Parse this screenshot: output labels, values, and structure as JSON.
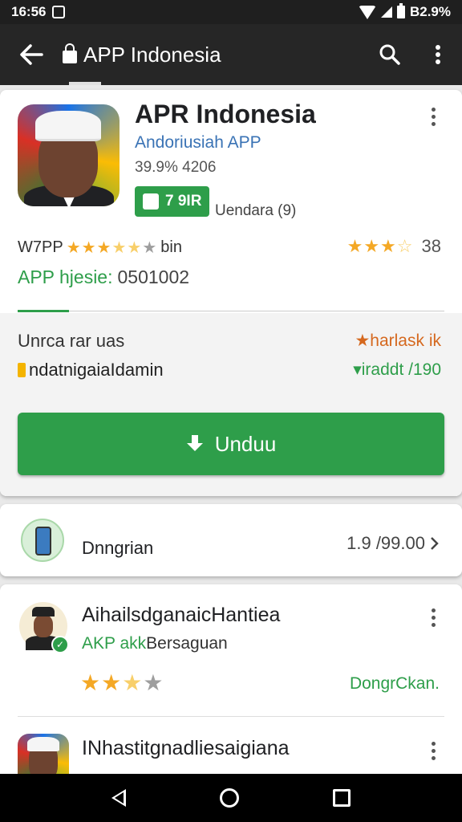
{
  "status": {
    "time": "16:56",
    "battery": "B2.9%"
  },
  "appbar": {
    "title": "APP Indonesia"
  },
  "app": {
    "name": "APR Indonesia",
    "developer": "Andoriusiah APP",
    "meta": "39.9%  4206",
    "badge": "7 9IR",
    "badge_aside": "Uendara (9)",
    "stats_left": "W7PP",
    "stats_left_suffix": "bin",
    "stars_left": 3.5,
    "stars_right": 3.5,
    "review_count": "38",
    "size_label": "APP hjesie:",
    "size_value": "0501002"
  },
  "info": {
    "line1": "Unrca rar uas",
    "line2": "ndatnigaiaIdamin",
    "line1_right": "★harlask ik",
    "line2_right": "▾iraddt /190"
  },
  "install": {
    "label": "Unduu"
  },
  "row": {
    "label": "Dnngrian",
    "value": "1.9 /99.00"
  },
  "review": {
    "name": "AihailsdganaicHantiea",
    "sub_green": "AKP akk",
    "sub_rest": "Bersaguan",
    "stars": 3,
    "action": "DongrCkan."
  },
  "review2": {
    "name": "INhastitgnadliesaigiana",
    "sub": " "
  },
  "colors": {
    "accent": "#2e9e4a",
    "bar": "#262626",
    "star": "#f4a825"
  }
}
